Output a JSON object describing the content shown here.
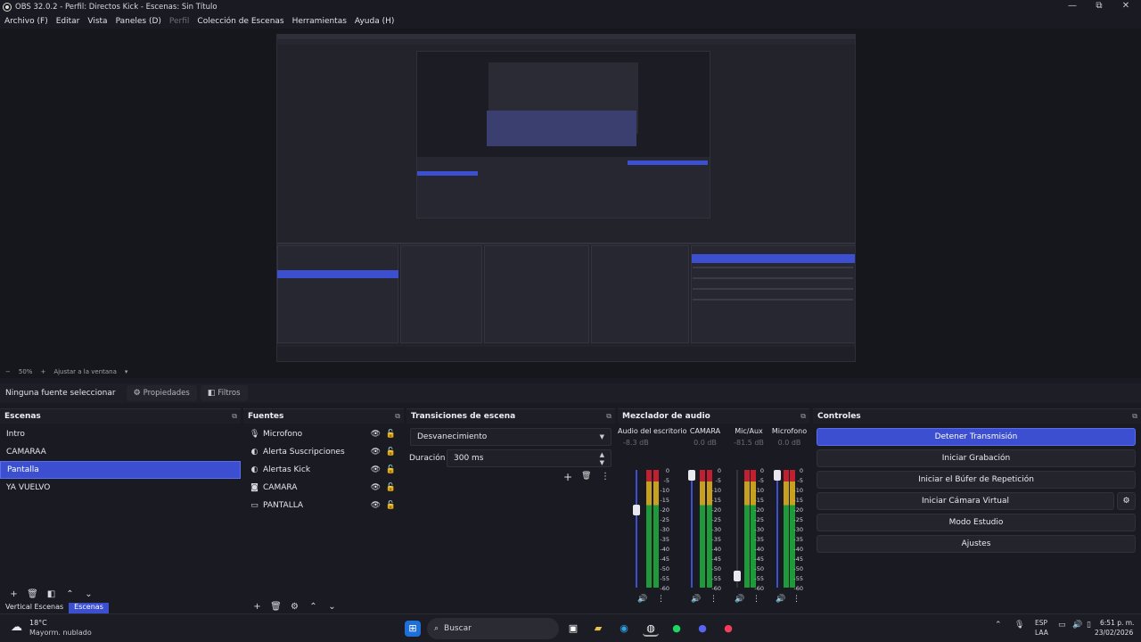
{
  "window": {
    "title": "OBS 32.0.2 - Perfil: Directos Kick - Escenas: Sin Título",
    "minimize": "—",
    "maximize": "⧉",
    "close": "✕"
  },
  "menu": [
    {
      "label": "Archivo (F)"
    },
    {
      "label": "Editar"
    },
    {
      "label": "Vista"
    },
    {
      "label": "Paneles (D)"
    },
    {
      "label": "Perfil",
      "disabled": true
    },
    {
      "label": "Colección de Escenas"
    },
    {
      "label": "Herramientas"
    },
    {
      "label": "Ayuda (H)"
    }
  ],
  "preview_footer": {
    "minus": "−",
    "zoom": "50%",
    "plus": "+",
    "fit": "Ajustar a la ventana",
    "arrow": "▾"
  },
  "source_toolbar": {
    "no_source": "Ninguna fuente seleccionar",
    "properties": "Propiedades",
    "filters": "Filtros"
  },
  "scenes": {
    "title": "Escenas",
    "items": [
      "Intro",
      "CAMARAA",
      "Pantalla",
      "YA VUELVO"
    ],
    "selected_index": 2,
    "bottom_tabs": [
      "Vertical Escenas",
      "Escenas"
    ]
  },
  "sources": {
    "title": "Fuentes",
    "items": [
      {
        "label": "Microfono",
        "icon": "mic-icon"
      },
      {
        "label": "Alerta Suscripciones",
        "icon": "browser-icon"
      },
      {
        "label": "Alertas Kick",
        "icon": "browser-icon"
      },
      {
        "label": "CAMARA",
        "icon": "camera-icon"
      },
      {
        "label": "PANTALLA",
        "icon": "monitor-icon"
      }
    ]
  },
  "transitions": {
    "title": "Transiciones de escena",
    "selected": "Desvanecimiento",
    "duration_label": "Duración",
    "duration_value": "300 ms"
  },
  "mixer": {
    "title": "Mezclador de audio",
    "scale": [
      "0",
      "-5",
      "-10",
      "-15",
      "-20",
      "-25",
      "-30",
      "-35",
      "-40",
      "-45",
      "-50",
      "-55",
      "-60"
    ],
    "channels": [
      {
        "name": "Audio del escritorio",
        "db": "-8.3 dB",
        "level": 0.69
      },
      {
        "name": "CAMARA",
        "db": "0.0 dB",
        "level": 1.0
      },
      {
        "name": "Mic/Aux",
        "db": "-81.5 dB",
        "level": 0.1
      },
      {
        "name": "Microfono",
        "db": "0.0 dB",
        "level": 1.0
      }
    ]
  },
  "controls": {
    "title": "Controles",
    "buttons": [
      "Detener Transmisión",
      "Iniciar Grabación",
      "Iniciar el Búfer de Repetición",
      "Iniciar Cámara Virtual",
      "Modo Estudio",
      "Ajustes"
    ]
  },
  "taskbar": {
    "weather_temp": "18°C",
    "weather_desc": "Mayorm. nublado",
    "search": "Buscar",
    "lang_top": "ESP",
    "lang_bottom": "LAA",
    "time": "6:51 p. m.",
    "date": "23/02/2026"
  },
  "colors": {
    "accent": "#3b4fd0",
    "background": "#1a1b22",
    "panel": "#1e1f26"
  }
}
